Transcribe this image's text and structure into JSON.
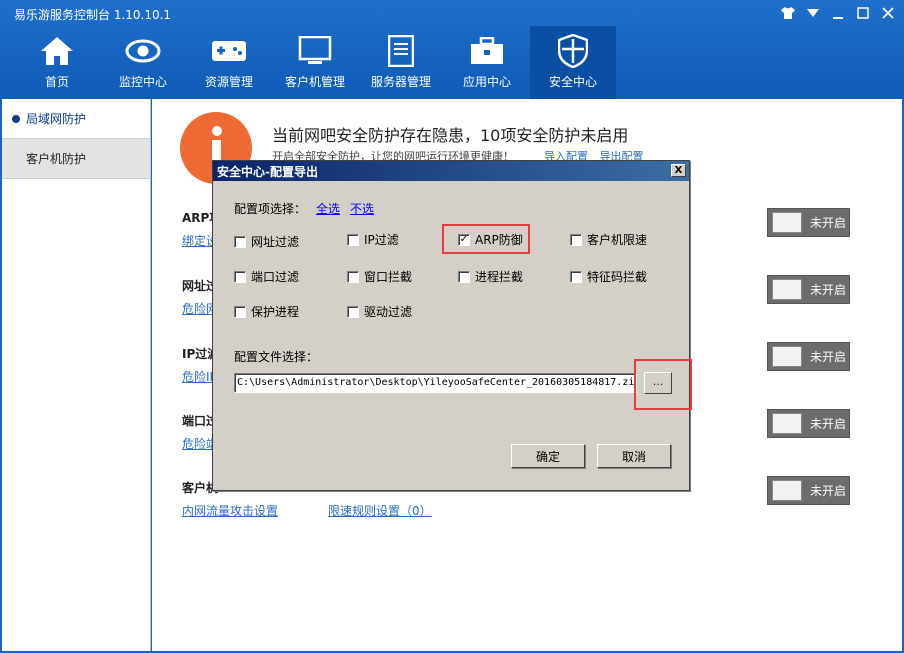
{
  "app": {
    "title": "易乐游服务控制台 1.10.10.1"
  },
  "nav": [
    {
      "label": "首页",
      "icon": "home-icon"
    },
    {
      "label": "监控中心",
      "icon": "eye-icon"
    },
    {
      "label": "资源管理",
      "icon": "gamepad-icon"
    },
    {
      "label": "客户机管理",
      "icon": "monitor-icon"
    },
    {
      "label": "服务器管理",
      "icon": "server-icon"
    },
    {
      "label": "应用中心",
      "icon": "toolbox-icon"
    },
    {
      "label": "安全中心",
      "icon": "shield-icon"
    }
  ],
  "sidebar": {
    "items": [
      {
        "label": "局域网防护"
      },
      {
        "label": "客户机防护"
      }
    ]
  },
  "main": {
    "alert_title": "当前网吧安全防护存在隐患，10项安全防护未启用",
    "alert_sub": "开启全部安全防护，让您的网吧运行环境更健康！",
    "import_link": "导入配置",
    "export_link": "导出配置",
    "sections": [
      {
        "title": "ARP项",
        "link": "绑定设"
      },
      {
        "title": "网址过",
        "link": "危险网"
      },
      {
        "title": "IP过滤",
        "link": "危险IP"
      },
      {
        "title": "端口过",
        "link": "危险端"
      },
      {
        "title": "客户机",
        "link": "内网流量攻击设置",
        "link2": "限速规则设置（0）"
      }
    ],
    "toggle_label": "未开启"
  },
  "dialog": {
    "title": "安全中心-配置导出",
    "close": "X",
    "config_label": "配置项选择：",
    "select_all": "全选",
    "select_none": "不选",
    "checkboxes": [
      {
        "label": "网址过滤",
        "checked": false
      },
      {
        "label": "IP过滤",
        "checked": false
      },
      {
        "label": "ARP防御",
        "checked": true
      },
      {
        "label": "客户机限速",
        "checked": false
      },
      {
        "label": "端口过滤",
        "checked": false
      },
      {
        "label": "窗口拦截",
        "checked": false
      },
      {
        "label": "进程拦截",
        "checked": false
      },
      {
        "label": "特征码拦截",
        "checked": false
      },
      {
        "label": "保护进程",
        "checked": false
      },
      {
        "label": "驱动过滤",
        "checked": false
      }
    ],
    "file_label": "配置文件选择：",
    "file_path": "C:\\Users\\Administrator\\Desktop\\YileyooSafeCenter_20160305184817.zip",
    "browse_label": "...",
    "ok_label": "确定",
    "cancel_label": "取消",
    "check_mark": "✓"
  },
  "colors": {
    "brand_blue": "#1565c0",
    "alert_orange": "#f06a35",
    "highlight_red": "#e8393f"
  }
}
